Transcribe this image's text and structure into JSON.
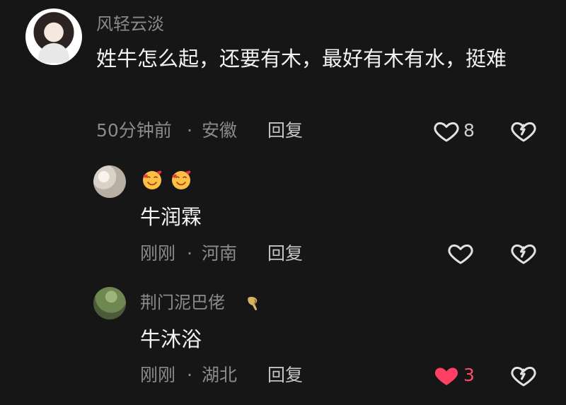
{
  "comments": [
    {
      "username": "风轻云淡",
      "text": "姓牛怎么起，还要有木，最好有木有水，挺难",
      "time": "50分钟前",
      "location": "安徽",
      "reply_label": "回复",
      "likes": "8"
    }
  ],
  "replies": [
    {
      "text": "牛润霖",
      "time": "刚刚",
      "location": "河南",
      "reply_label": "回复"
    },
    {
      "username": "荆门泥巴佬",
      "text": "牛沐浴",
      "time": "刚刚",
      "location": "湖北",
      "reply_label": "回复",
      "likes": "3"
    }
  ],
  "icons": {
    "like": "heart-outline-icon",
    "liked": "heart-filled-icon",
    "dislike": "broken-heart-icon",
    "emoji": "smiling-face-with-hearts-icon",
    "badge": "arm-badge-icon"
  },
  "colors": {
    "background": "#161616",
    "text": "#f2f2f2",
    "muted": "#8b8b8b",
    "liked": "#ff3f63"
  }
}
